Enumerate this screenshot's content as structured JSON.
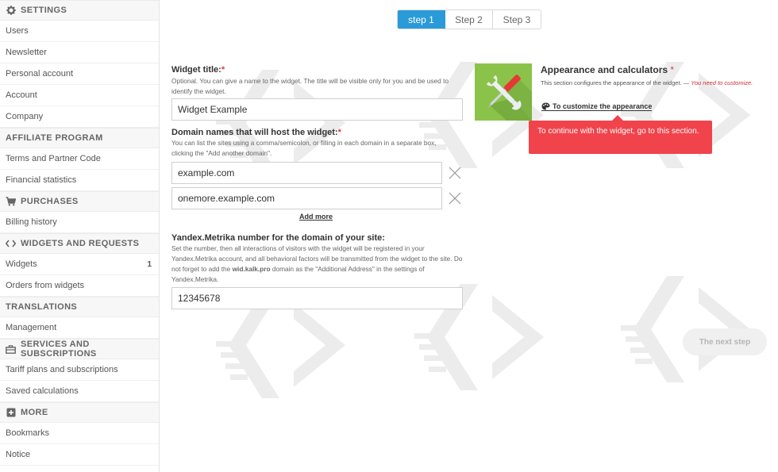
{
  "sidebar": {
    "sections": [
      {
        "title": "SETTINGS",
        "icon": "gear-icon",
        "items": [
          {
            "label": "Users"
          },
          {
            "label": "Newsletter"
          },
          {
            "label": "Personal account"
          },
          {
            "label": "Account"
          },
          {
            "label": "Company"
          }
        ]
      },
      {
        "title": "AFFILIATE PROGRAM",
        "icon": "",
        "items": [
          {
            "label": "Terms and Partner Code"
          },
          {
            "label": "Financial statistics"
          }
        ]
      },
      {
        "title": "PURCHASES",
        "icon": "cart-icon",
        "items": [
          {
            "label": "Billing history"
          }
        ]
      },
      {
        "title": "WIDGETS AND REQUESTS",
        "icon": "code-icon",
        "items": [
          {
            "label": "Widgets",
            "count": "1"
          },
          {
            "label": "Orders from widgets"
          }
        ]
      },
      {
        "title": "TRANSLATIONS",
        "icon": "",
        "items": [
          {
            "label": "Management"
          }
        ]
      },
      {
        "title": "SERVICES AND SUBSCRIPTIONS",
        "icon": "briefcase-icon",
        "items": [
          {
            "label": "Tariff plans and subscriptions"
          },
          {
            "label": "Saved calculations"
          }
        ]
      },
      {
        "title": "MORE",
        "icon": "plus-box-icon",
        "items": [
          {
            "label": "Bookmarks"
          },
          {
            "label": "Notice"
          }
        ]
      }
    ]
  },
  "steps": [
    "step 1",
    "Step 2",
    "Step 3"
  ],
  "form": {
    "widget_title": {
      "label": "Widget title:",
      "required": "*",
      "hint": "Optional. You can give a name to the widget. The title will be visible only for you and be used to identify the widget.",
      "value": "Widget Example"
    },
    "domains": {
      "label": "Domain names that will host the widget:",
      "required": "*",
      "hint": "You can list the sites using a comma/semicolon, or filling in each domain in a separate box, clicking the \"Add another domain\".",
      "values": [
        "example.com",
        "onemore.example.com"
      ],
      "add_more": "Add more"
    },
    "metrika": {
      "label": "Yandex.Metrika number for the domain of your site:",
      "hint_before": "Set the number, then all interactions of visitors with the widget will be registered in your Yandex.Metrika account, and all behavioral factors will be transmitted from the widget to the site. Do not forget to add the ",
      "hint_bold": "wid.kalk.pro",
      "hint_after": " domain as the \"Additional Address\" in the settings of Yandex.Metrika.",
      "value": "12345678"
    }
  },
  "appearance": {
    "title": "Appearance and calculators",
    "required": "*",
    "desc": "This section configures the appearance of the widget. — ",
    "warn": "You need to customize.",
    "customize_label": "To customize the appearance",
    "tooltip": "To continue with the widget, go to this section.",
    "icon_color": "#8bc34a"
  },
  "next_button": "The next step",
  "colors": {
    "accent": "#2a9bd8",
    "tooltip": "#f1434b",
    "required": "#e03a3a"
  }
}
